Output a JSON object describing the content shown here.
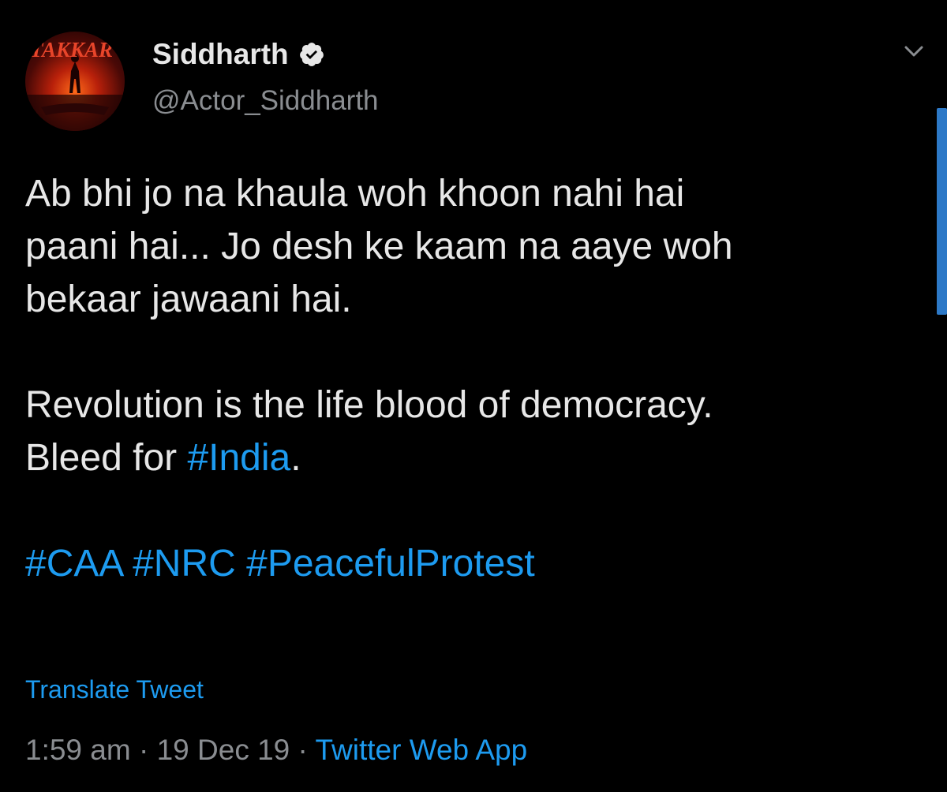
{
  "author": {
    "display_name": "Siddharth",
    "handle": "@Actor_Siddharth",
    "avatar_text": "TAKKAR",
    "verified": true
  },
  "tweet": {
    "lines": [
      "Ab bhi jo na khaula woh khoon nahi hai",
      "paani hai... Jo desh ke kaam na aaye woh",
      "bekaar jawaani hai."
    ],
    "revolution_line": "Revolution is the life blood of democracy.",
    "bleed_prefix": "Bleed for ",
    "bleed_hashtag": "#India",
    "bleed_suffix": ".",
    "hashtags": [
      "#CAA",
      "#NRC",
      "#PeacefulProtest"
    ]
  },
  "translate_label": "Translate Tweet",
  "meta": {
    "time": "1:59 am",
    "separator": " · ",
    "date": "19 Dec 19",
    "source": "Twitter Web App"
  },
  "icons": {
    "verified": "verified-badge-icon",
    "menu": "chevron-down-icon"
  },
  "colors": {
    "background": "#000000",
    "text": "#e7e7e7",
    "secondary": "#8a8d91",
    "link": "#1d9bf0"
  }
}
